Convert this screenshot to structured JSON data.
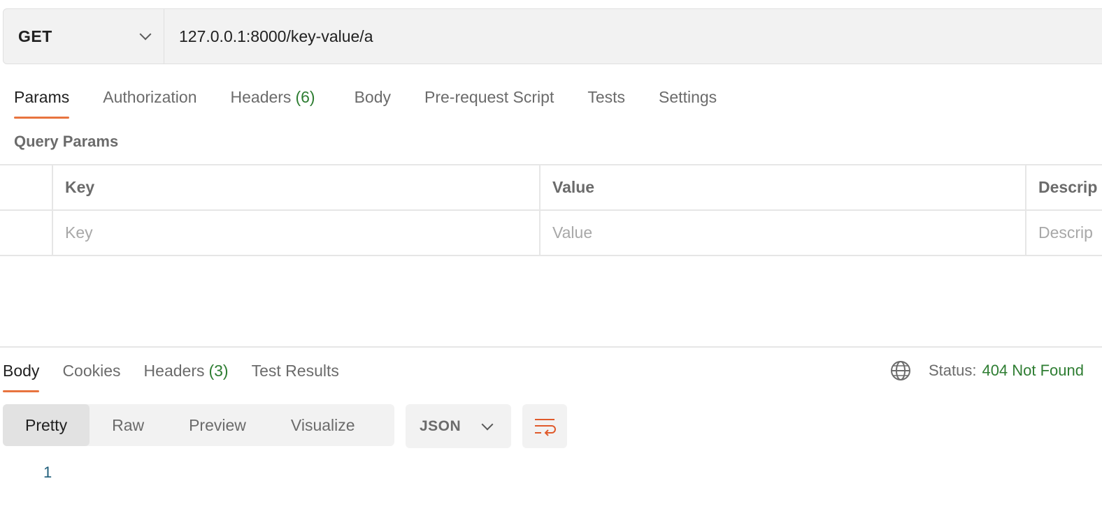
{
  "request": {
    "method": "GET",
    "url": "127.0.0.1:8000/key-value/a"
  },
  "request_tabs": {
    "params": "Params",
    "authorization": "Authorization",
    "headers": "Headers",
    "headers_count": "(6)",
    "body": "Body",
    "pre_request_script": "Pre-request Script",
    "tests": "Tests",
    "settings": "Settings"
  },
  "query_params": {
    "title": "Query Params",
    "columns": {
      "key": "Key",
      "value": "Value",
      "description": "Descrip"
    },
    "placeholders": {
      "key": "Key",
      "value": "Value",
      "description": "Descrip"
    }
  },
  "response_tabs": {
    "body": "Body",
    "cookies": "Cookies",
    "headers": "Headers",
    "headers_count": "(3)",
    "test_results": "Test Results"
  },
  "status": {
    "label": "Status:",
    "value": "404 Not Found"
  },
  "view_modes": {
    "pretty": "Pretty",
    "raw": "Raw",
    "preview": "Preview",
    "visualize": "Visualize"
  },
  "format": "JSON",
  "code": {
    "line_number": "1"
  },
  "colors": {
    "accent": "#e8743f",
    "success": "#2e7d32"
  },
  "icons": {
    "method_dropdown": "chevron-down-icon",
    "format_dropdown": "chevron-down-icon",
    "globe": "globe-icon",
    "wrap": "wrap-lines-icon"
  }
}
